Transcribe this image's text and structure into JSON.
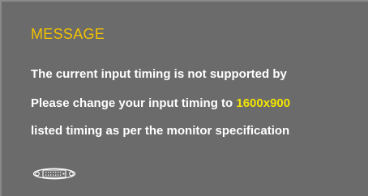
{
  "osd": {
    "title": "MESSAGE",
    "line1": "The current input timing is not supported by",
    "line2_prefix": "Please change your input timing to ",
    "line2_highlight": "1600x900",
    "line3": "listed timing as per the monitor specification",
    "connector_icon": "dvi-connector-icon"
  },
  "colors": {
    "background": "#6b6b6b",
    "title": "#f2c200",
    "text": "#ffffff",
    "highlight": "#f2e400"
  }
}
